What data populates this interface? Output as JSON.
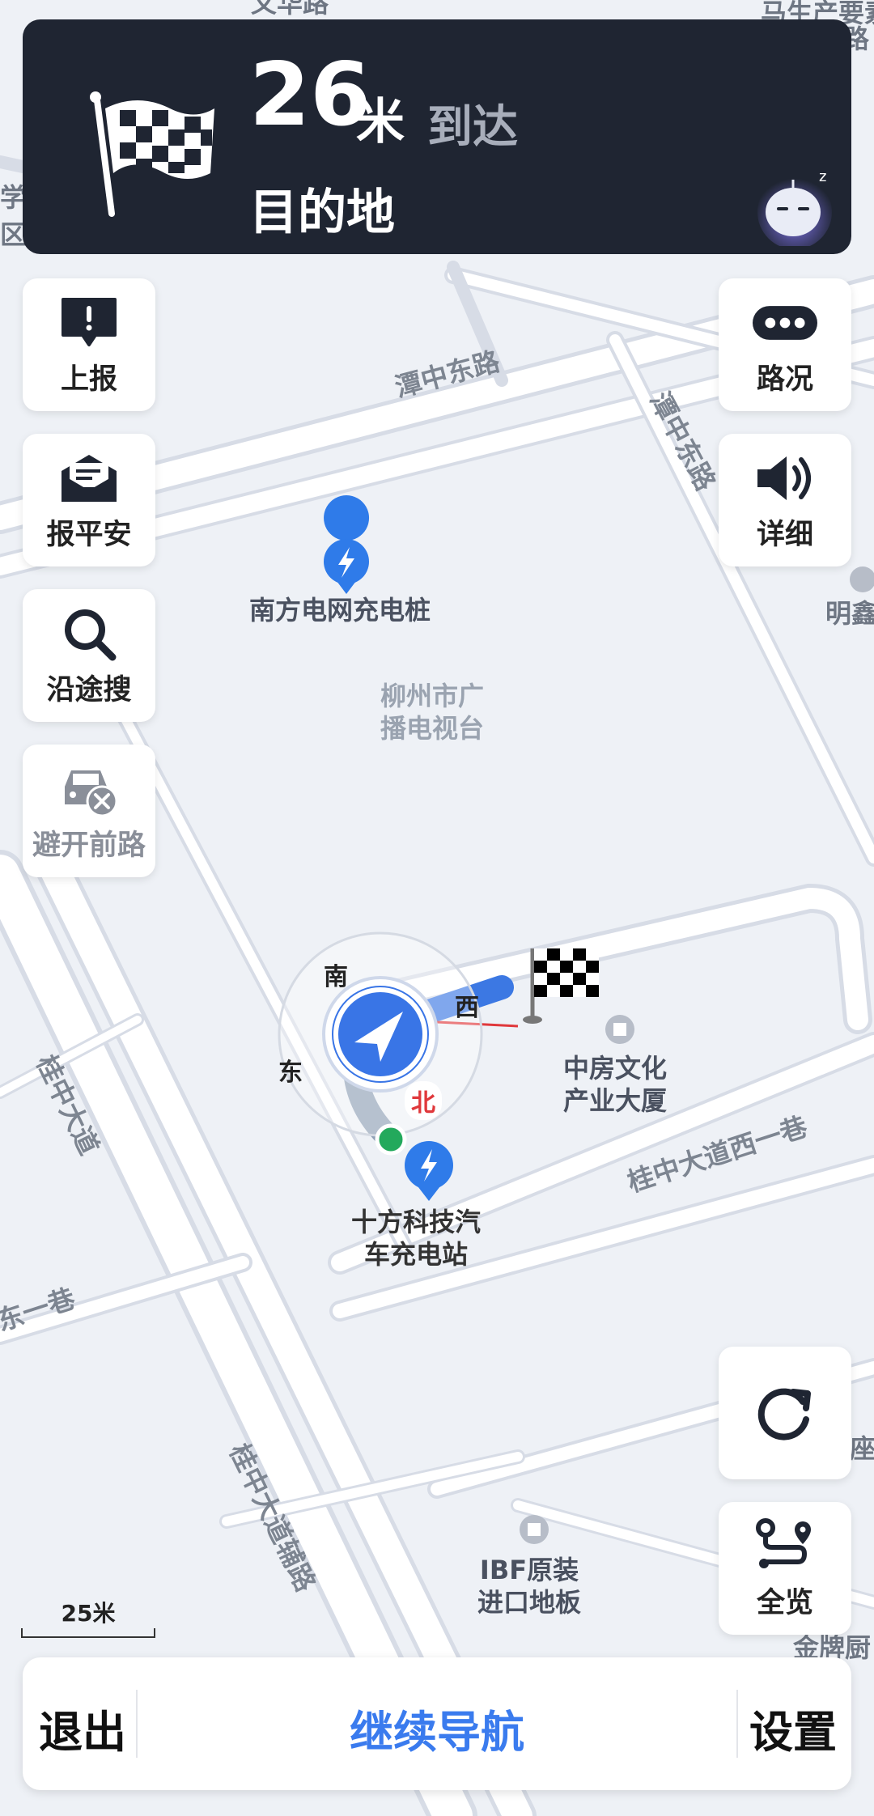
{
  "banner": {
    "distance": "26",
    "unit": "米",
    "arrive": "到达",
    "destination": "目的地"
  },
  "left_buttons": [
    {
      "label": "上报",
      "icon": "report-icon"
    },
    {
      "label": "报平安",
      "icon": "safety-envelope-icon"
    },
    {
      "label": "沿途搜",
      "icon": "search-icon"
    },
    {
      "label": "避开前路",
      "icon": "avoid-car-icon"
    }
  ],
  "right_buttons": [
    {
      "label": "路况",
      "icon": "traffic-dots-icon"
    },
    {
      "label": "详细",
      "icon": "speaker-icon"
    },
    {
      "label": "",
      "icon": "refresh-icon"
    },
    {
      "label": "全览",
      "icon": "route-overview-icon"
    }
  ],
  "map": {
    "roads": [
      "潭中东路",
      "潭中东路",
      "桂中大道",
      "桂中大道西一巷",
      "东一巷",
      "桂中大道辅路"
    ],
    "pois": [
      "南方电网充电桩",
      "柳州市广\n播电视台",
      "中房文化\n产业大厦",
      "十方科技汽\n车充电站",
      "IBF原装\n进口地板",
      "明鑫",
      "金牌厨"
    ],
    "top_texts": [
      "义华路",
      "马生产要素",
      "分路",
      "学",
      "区",
      "座"
    ],
    "compass": {
      "south": "南",
      "west": "西",
      "east": "东",
      "north": "北"
    }
  },
  "scale": "25米",
  "bottom_bar": {
    "exit": "退出",
    "continue": "继续导航",
    "settings": "设置"
  }
}
